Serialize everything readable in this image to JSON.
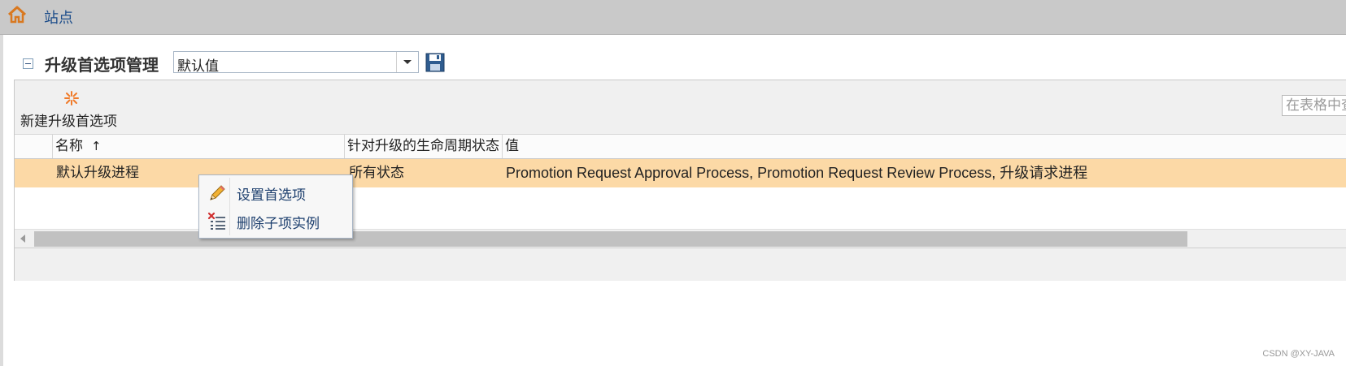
{
  "topbar": {
    "title": "站点",
    "home_icon": "home-icon"
  },
  "section": {
    "title": "升级首选项管理",
    "collapse_icon": "collapse-icon",
    "select_value": "默认值",
    "save_icon": "save-icon"
  },
  "toolbar": {
    "new_label": "新建升级首选项",
    "new_icon": "new-item-icon",
    "search_placeholder": "在表格中查找"
  },
  "table": {
    "columns": [
      {
        "label": "",
        "sort": ""
      },
      {
        "label": "名称",
        "sort": "↑"
      },
      {
        "label": "针对升级的生命周期状态",
        "sort": ""
      },
      {
        "label": "值",
        "sort": ""
      }
    ],
    "rows": [
      {
        "name": "默认升级进程",
        "state": "所有状态",
        "value": "Promotion Request Approval Process, Promotion Request Review Process, 升级请求进程"
      }
    ],
    "selected_row_color": "#fcd9a6"
  },
  "context_menu": {
    "items": [
      {
        "label": "设置首选项",
        "icon": "pencil-icon"
      },
      {
        "label": "删除子项实例",
        "icon": "delete-children-icon"
      }
    ]
  },
  "watermark": "CSDN @XY-JAVA"
}
